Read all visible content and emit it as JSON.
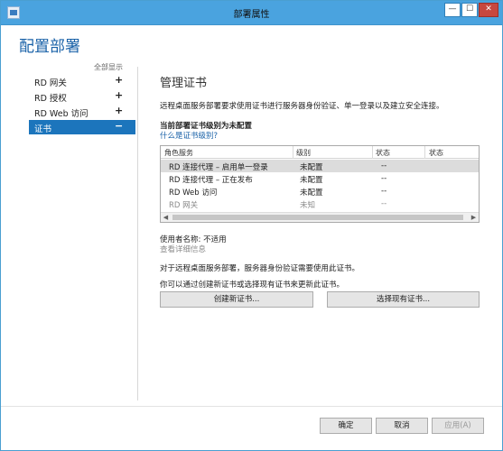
{
  "window": {
    "title": "部署属性"
  },
  "left_pane": {
    "title": "配置部署",
    "show_all": "全部显示",
    "items": [
      {
        "label": "RD 网关",
        "toggle": "+"
      },
      {
        "label": "RD 授权",
        "toggle": "+"
      },
      {
        "label": "RD Web 访问",
        "toggle": "+"
      },
      {
        "label": "证书",
        "toggle": "−",
        "selected": true
      }
    ]
  },
  "main": {
    "title": "管理证书",
    "description": "远程桌面服务部署要求使用证书进行服务器身份验证、单一登录以及建立安全连接。",
    "level_label": "当前部署证书级别为未配置",
    "help_link": "什么是证书级别?",
    "table": {
      "headers": [
        "角色服务",
        "级别",
        "状态",
        "状态"
      ],
      "rows": [
        {
          "role": "RD 连接代理 – 启用单一登录",
          "level": "未配置",
          "status": "--",
          "selected": true
        },
        {
          "role": "RD 连接代理 – 正在发布",
          "level": "未配置",
          "status": "--"
        },
        {
          "role": "RD Web 访问",
          "level": "未配置",
          "status": "--"
        },
        {
          "role": "RD 网关",
          "level": "未知",
          "status": "--",
          "dimmed": true
        }
      ]
    },
    "user_name": "使用者名称: 不适用",
    "view_details": "查看详细信息",
    "info1": "对于远程桌面服务部署，服务器身份验证需要使用此证书。",
    "info2": "你可以通过创建新证书或选择现有证书来更新此证书。",
    "create_button": "创建新证书...",
    "select_button": "选择现有证书..."
  },
  "footer": {
    "ok": "确定",
    "cancel": "取消",
    "apply": "应用(A)"
  }
}
